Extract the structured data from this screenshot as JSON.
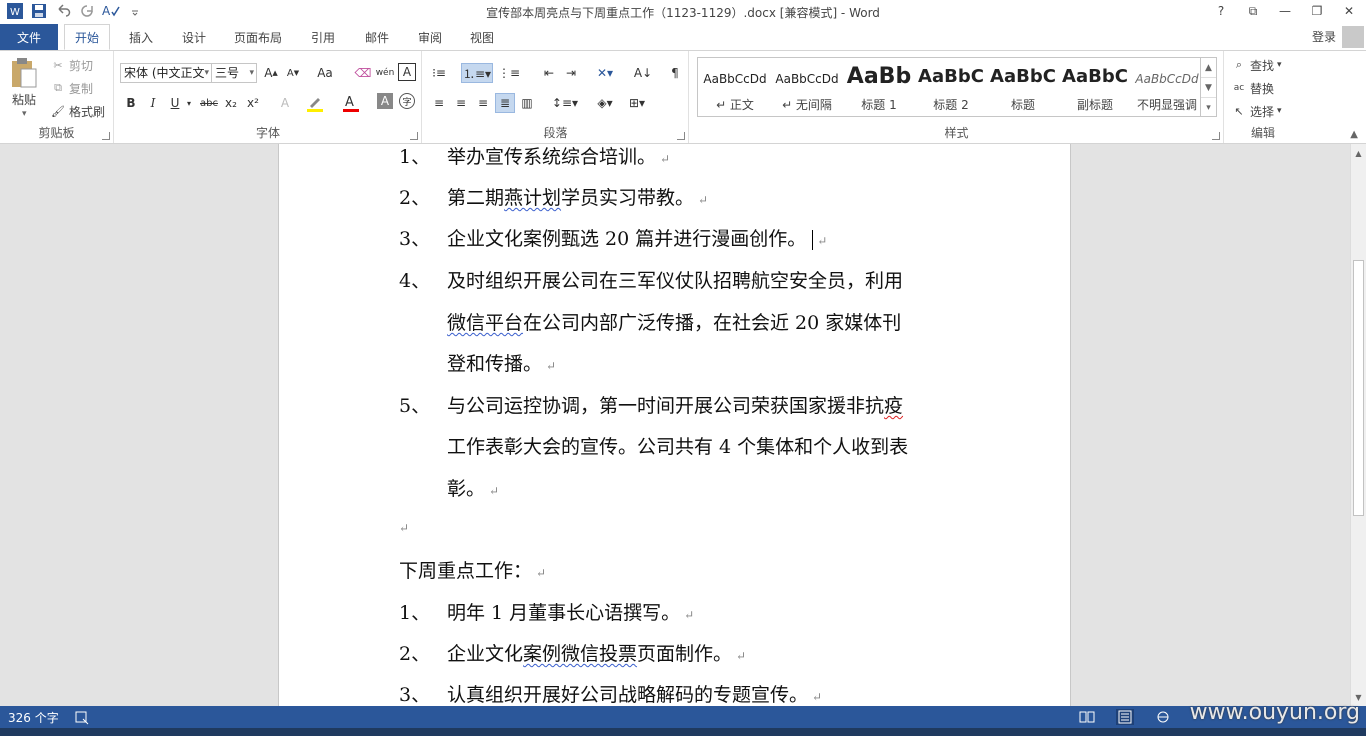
{
  "window": {
    "title": "宣传部本周亮点与下周重点工作（1123-1129）.docx [兼容模式] - Word",
    "help": "?",
    "restore_ribbon": "⧉",
    "minimize": "—",
    "maximize": "❐",
    "close": "✕"
  },
  "tabs": {
    "file": "文件",
    "items": [
      "开始",
      "插入",
      "设计",
      "页面布局",
      "引用",
      "邮件",
      "审阅",
      "视图"
    ],
    "login": "登录"
  },
  "clipboard": {
    "paste": "粘贴",
    "cut": "剪切",
    "copy": "复制",
    "format_painter": "格式刷",
    "label": "剪贴板"
  },
  "font": {
    "family": "宋体 (中文正文",
    "size": "三号",
    "label": "字体",
    "change_case": "Aa",
    "bold": "B",
    "italic": "I",
    "underline": "U",
    "strike": "abc",
    "subscript": "x₂",
    "superscript": "x²"
  },
  "paragraph": {
    "label": "段落"
  },
  "styles": {
    "label": "样式",
    "items": [
      {
        "sample": "AaBbCcDd",
        "name": "↵ 正文"
      },
      {
        "sample": "AaBbCcDd",
        "name": "↵ 无间隔"
      },
      {
        "sample": "AaBb",
        "name": "标题 1"
      },
      {
        "sample": "AaBbC",
        "name": "标题 2"
      },
      {
        "sample": "AaBbC",
        "name": "标题"
      },
      {
        "sample": "AaBbC",
        "name": "副标题"
      },
      {
        "sample": "AaBbCcDd",
        "name": "不明显强调"
      }
    ]
  },
  "editing": {
    "find": "查找",
    "replace": "替换",
    "select": "选择",
    "label": "编辑"
  },
  "document": {
    "lines": [
      {
        "num": "1、",
        "text": "举办宣传系统综合培训。"
      },
      {
        "num": "2、",
        "pre": "第二期",
        "squig": "燕计划",
        "post": "学员实习带教。"
      },
      {
        "num": "3、",
        "text": "企业文化案例甄选 20 篇并进行漫画创作。"
      },
      {
        "num": "4、",
        "text": "及时组织开展公司在三军仪仗队招聘航空安全员，利用"
      },
      {
        "num": "",
        "squig": "微信平台",
        "post": "在公司内部广泛传播，在社会近 20 家媒体刊"
      },
      {
        "num": "",
        "text": "登和传播。"
      },
      {
        "num": "5、",
        "pre": "与公司运控协调，第一时间开展公司荣获国家援非抗",
        "squig": "疫"
      },
      {
        "num": "",
        "text": "工作表彰大会的宣传。公司共有 4 个集体和个人收到表"
      },
      {
        "num": "",
        "text": "彰。"
      },
      {
        "num": "",
        "text": ""
      },
      {
        "num": "",
        "heading": "下周重点工作："
      },
      {
        "num": "1、",
        "text": "明年 1 月董事长心语撰写。"
      },
      {
        "num": "2、",
        "pre": "企业文化",
        "squig": "案例微信投票",
        "post": "页面制作。"
      },
      {
        "num": "3、",
        "text": "认真组织开展好公司战略解码的专题宣传。"
      }
    ],
    "para_mark": "↵"
  },
  "status": {
    "word_count": "326 个字",
    "watermark": "www.ouyun.org"
  },
  "colors": {
    "accent": "#2b579a"
  }
}
